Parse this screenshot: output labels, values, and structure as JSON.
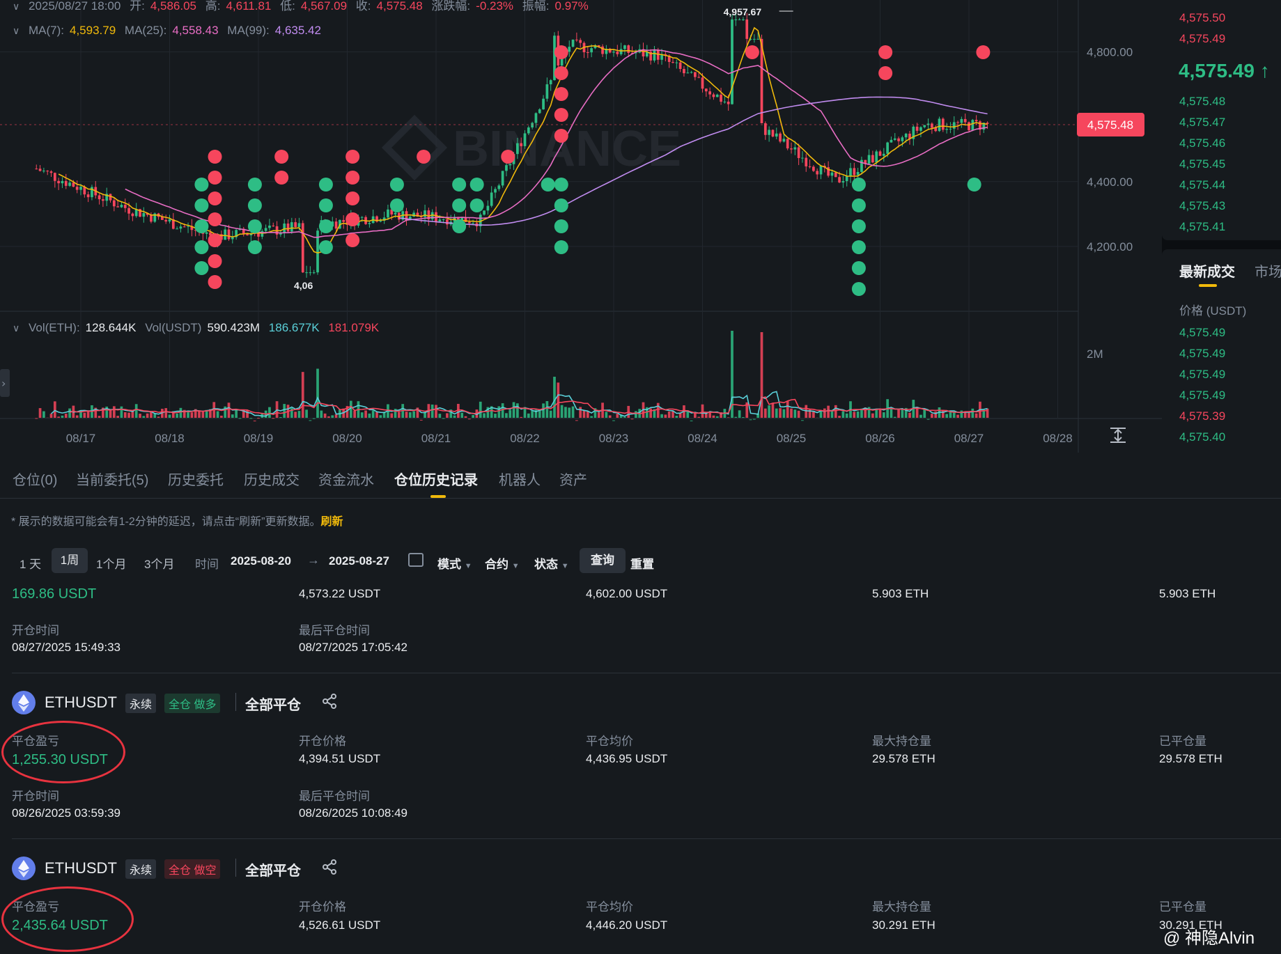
{
  "ohlc": {
    "date": "2025/08/27 18:00",
    "open_label": "开:",
    "open": "4,586.05",
    "high_label": "高:",
    "high": "4,611.81",
    "low_label": "低:",
    "low": "4,567.09",
    "close_label": "收:",
    "close": "4,575.48",
    "change_label": "涨跌幅:",
    "change": "-0.23%",
    "amp_label": "振幅:",
    "amp": "0.97%"
  },
  "ma": {
    "ma7_label": "MA(7):",
    "ma7": "4,593.79",
    "ma25_label": "MA(25):",
    "ma25": "4,558.43",
    "ma99_label": "MA(99):",
    "ma99": "4,635.42"
  },
  "vol": {
    "eth_label": "Vol(ETH):",
    "eth": "128.644K",
    "usdt_label": "Vol(USDT)",
    "usdt": "590.423M",
    "ma1": "186.677K",
    "ma2": "181.079K"
  },
  "watermark": "BINANCE",
  "price_axis": [
    "4,800.00",
    "4,400.00",
    "4,200.00"
  ],
  "vol_axis": [
    "2M"
  ],
  "current_price_tag": "4,575.48",
  "high_marker": "4,957.67",
  "low_marker": "4,06",
  "date_axis": [
    "08/17",
    "08/18",
    "08/19",
    "08/20",
    "08/21",
    "08/22",
    "08/23",
    "08/24",
    "08/25",
    "08/26",
    "08/27",
    "08/28"
  ],
  "colors": {
    "up": "#2ebd85",
    "down": "#f6465d",
    "ma7": "#f0b90b",
    "ma25": "#e86dc4",
    "ma99": "#c18cf0",
    "accent": "#f0b90b"
  },
  "chart_data": {
    "type": "candlestick",
    "interval": "1h",
    "ylim": [
      4000,
      4960
    ],
    "price_ticks": [
      4200,
      4400,
      4800
    ],
    "last_close": 4575.48,
    "high_marker": 4957.67,
    "close_by_day": [
      {
        "x": "08/17",
        "close": 4440
      },
      {
        "x": "08/18",
        "close": 4320
      },
      {
        "x": "08/19",
        "close": 4230
      },
      {
        "x": "08/20",
        "close": 4260
      },
      {
        "x": "08/21",
        "close": 4300
      },
      {
        "x": "08/22",
        "close": 4280
      },
      {
        "x": "08/23",
        "close": 4820
      },
      {
        "x": "08/24",
        "close": 4790
      },
      {
        "x": "08/25",
        "close": 4600
      },
      {
        "x": "08/26",
        "close": 4400
      },
      {
        "x": "08/27",
        "close": 4575
      }
    ]
  },
  "orderbook": {
    "asks": [
      "4,575.50",
      "4,575.49"
    ],
    "last_price": "4,575.49",
    "bids": [
      "4,575.48",
      "4,575.47",
      "4,575.46",
      "4,575.45",
      "4,575.44",
      "4,575.43",
      "4,575.41"
    ]
  },
  "trades": {
    "tab1": "最新成交",
    "tab2": "市场",
    "price_header": "价格 (USDT)",
    "prices": [
      {
        "p": "4,575.49",
        "side": "green"
      },
      {
        "p": "4,575.49",
        "side": "green"
      },
      {
        "p": "4,575.49",
        "side": "green"
      },
      {
        "p": "4,575.49",
        "side": "green"
      },
      {
        "p": "4,575.39",
        "side": "red"
      },
      {
        "p": "4,575.40",
        "side": "green"
      }
    ]
  },
  "tabs": [
    "仓位(0)",
    "当前委托(5)",
    "历史委托",
    "历史成交",
    "资金流水",
    "仓位历史记录",
    "机器人",
    "资产"
  ],
  "active_tab": 5,
  "notice": "* 展示的数据可能会有1-2分钟的延迟，请点击“刷新”更新数据。",
  "refresh": "刷新",
  "filters": {
    "ranges": [
      "1 天",
      "1周",
      "1个月",
      "3个月"
    ],
    "time_label": "时间",
    "start": "2025-08-20",
    "end": "2025-08-27",
    "mode": "模式",
    "contract": "合约",
    "status": "状态",
    "query": "查询",
    "reset": "重置"
  },
  "labels": {
    "pnl": "平仓盈亏",
    "open_price": "开仓价格",
    "avg_close": "平仓均价",
    "max_pos": "最大持仓量",
    "closed_qty": "已平仓量",
    "open_time": "开仓时间",
    "last_close_time": "最后平仓时间"
  },
  "record0": {
    "pnl": "169.86 USDT",
    "open_price": "4,573.22 USDT",
    "avg_close": "4,602.00 USDT",
    "max_pos": "5.903 ETH",
    "closed_qty": "5.903 ETH",
    "open_time": "08/27/2025 15:49:33",
    "last_close_time": "08/27/2025 17:05:42"
  },
  "record1": {
    "symbol": "ETHUSDT",
    "type": "永续",
    "margin": "全仓 做多",
    "close_all": "全部平仓",
    "pnl": "1,255.30 USDT",
    "open_price": "4,394.51 USDT",
    "avg_close": "4,436.95 USDT",
    "max_pos": "29.578 ETH",
    "closed_qty": "29.578 ETH",
    "open_time": "08/26/2025 03:59:39",
    "last_close_time": "08/26/2025 10:08:49"
  },
  "record2": {
    "symbol": "ETHUSDT",
    "type": "永续",
    "margin": "全仓 做空",
    "close_all": "全部平仓",
    "pnl": "2,435.64 USDT",
    "open_price": "4,526.61 USDT",
    "avg_close": "4,446.20 USDT",
    "max_pos": "30.291 ETH",
    "closed_qty": "30.291 ETH"
  },
  "author_watermark": "@ 神隐Alvin"
}
